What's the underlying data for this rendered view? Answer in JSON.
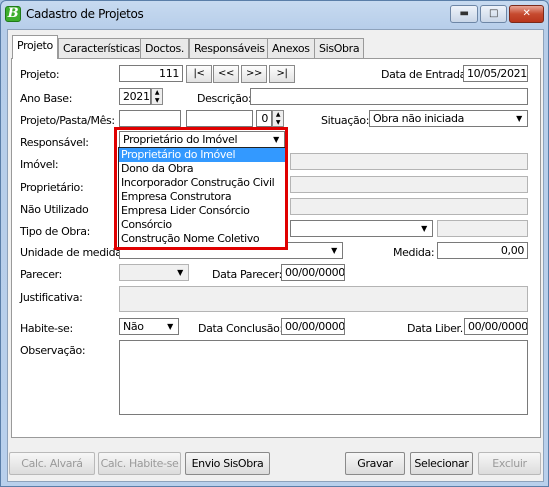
{
  "window": {
    "title": "Cadastro de Projetos",
    "icon_letter": "B"
  },
  "tabs": [
    {
      "label": "Projeto"
    },
    {
      "label": "Características"
    },
    {
      "label": "Doctos."
    },
    {
      "label": "Responsáveis"
    },
    {
      "label": "Anexos"
    },
    {
      "label": "SisObra"
    }
  ],
  "form": {
    "projeto_label": "Projeto:",
    "projeto_value": "111",
    "nav_first": "|<",
    "nav_prev": "<<",
    "nav_next": ">>",
    "nav_last": ">|",
    "data_entrada_label": "Data de Entrada:",
    "data_entrada_value": "10/05/2021",
    "ano_base_label": "Ano Base:",
    "ano_base_value": "2021",
    "descricao_label": "Descrição:",
    "descricao_value": "",
    "projeto_pasta_label": "Projeto/Pasta/Mês:",
    "pasta_value_1": "",
    "pasta_value_2": "",
    "mes_value": "0",
    "situacao_label": "Situação:",
    "situacao_value": "Obra não iniciada",
    "responsavel_label": "Responsável:",
    "responsavel_value": "Proprietário do Imóvel",
    "imovel_label": "Imóvel:",
    "proprietario_label": "Proprietário:",
    "nao_utilizado_label": "Não Utilizado",
    "tipo_obra_label": "Tipo de Obra:",
    "unidade_medida_label": "Unidade de medida:",
    "medida_label": "Medida:",
    "medida_value": "0,00",
    "parecer_label": "Parecer:",
    "data_parecer_label": "Data Parecer:",
    "data_parecer_value": "00/00/0000",
    "justificativa_label": "Justificativa:",
    "habite_se_label": "Habite-se:",
    "habite_se_value": "Não",
    "data_conclusao_label": "Data Conclusão:",
    "data_conclusao_value": "00/00/0000",
    "data_liber_label": "Data Liber.:",
    "data_liber_value": "00/00/0000",
    "observacao_label": "Observação:"
  },
  "responsavel_dropdown": {
    "options": [
      "Proprietário do Imóvel",
      "Dono da Obra",
      "Incorporador Construção Civil",
      "Empresa Construtora",
      "Empresa Lider Consórcio",
      "Consórcio",
      "Construção Nome Coletivo"
    ],
    "selected": "Proprietário do Imóvel",
    "highlight_color": "#e00000"
  },
  "buttons": {
    "calc_alvara": "Calc. Alvará",
    "calc_habite": "Calc. Habite-se",
    "envio_sisobra": "Envio SisObra",
    "gravar": "Gravar",
    "selecionar": "Selecionar",
    "excluir": "Excluir"
  }
}
